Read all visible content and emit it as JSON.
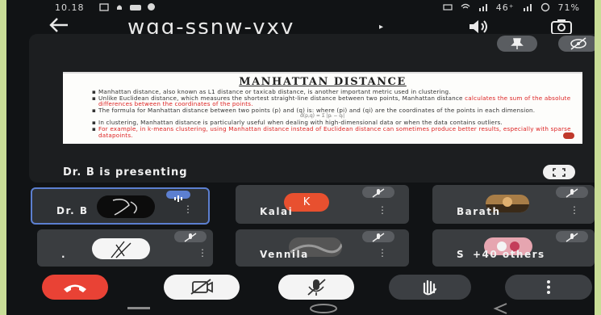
{
  "status_bar": {
    "time": "10.18",
    "network": "46⁺",
    "battery": "71%"
  },
  "header": {
    "meeting_code": "wgg-ssnw-vxv",
    "caret": "▸"
  },
  "slide": {
    "title": "MANHATTAN DISTANCE",
    "bullets": [
      {
        "plain": "Manhattan distance, also known as L1 distance or taxicab distance, is another important metric used in clustering.",
        "red": ""
      },
      {
        "plain": "Unlike Euclidean distance, which measures the shortest straight-line distance between two points, Manhattan distance ",
        "red": "calculates the sum of the absolute differences between the coordinates of the points."
      },
      {
        "plain": "The formula for Manhattan distance between two points (p) and (q) is: where (pi) and (qi) are the coordinates of the points in each dimension.",
        "red": ""
      },
      {
        "plain": "In clustering, Manhattan distance is particularly useful when dealing with high-dimensional data or when the data contains outliers.",
        "red": ""
      },
      {
        "plain": "",
        "red": "For example, in k-means clustering, using Manhattan distance instead of Euclidean distance can sometimes produce better results, especially with sparse datapoints."
      }
    ],
    "formula": "d(p,q) = Σ |pᵢ − qᵢ|"
  },
  "stage": {
    "presenter_label": "Dr. B is presenting"
  },
  "participants": [
    {
      "name": "Dr. B",
      "avatar_letter": ""
    },
    {
      "name": "Kalai",
      "avatar_letter": "K"
    },
    {
      "name": "Barath",
      "avatar_letter": ""
    },
    {
      "name": ".",
      "avatar_letter": ""
    },
    {
      "name": "Vennila",
      "avatar_letter": ""
    },
    {
      "name": "+40 others",
      "avatar_letter": "S"
    }
  ],
  "more_glyph": "⋮",
  "colors": {
    "end_call": "#e94235",
    "active_speaker": "#5c7fd0",
    "kalai_avatar": "#e8502f"
  }
}
